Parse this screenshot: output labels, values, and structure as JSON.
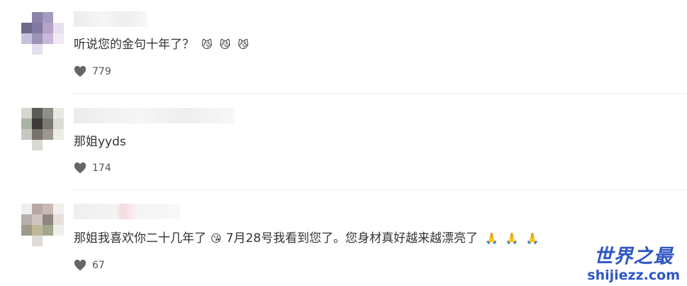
{
  "comments": [
    {
      "text": "听说您的金句十年了？",
      "emojis": [
        "😼",
        "😼",
        "😼"
      ],
      "likes": "779",
      "avatar_colors": [
        "#ffffff",
        "#8b84a8",
        "#a49cc0",
        "#ffffff",
        "#6e6a8e",
        "#7f79a4",
        "#b7a3c6",
        "#e6e0ee",
        "#c9c1dc",
        "#9d93b6",
        "#c7b7d8",
        "#f0eaf4",
        "#ffffff",
        "#e4dff0",
        "#ffffff",
        "#ffffff"
      ]
    },
    {
      "text": "那姐yyds",
      "emojis": [],
      "likes": "174",
      "avatar_colors": [
        "#d6d6d0",
        "#5b5b58",
        "#8f8e88",
        "#e8e8e4",
        "#a9b3a6",
        "#3c3a38",
        "#7c7872",
        "#dcdcd6",
        "#c5c7c0",
        "#77726c",
        "#9b968e",
        "#ebebe7",
        "#ffffff",
        "#d9d8d2",
        "#ffffff",
        "#ffffff"
      ]
    },
    {
      "text": "那姐我喜欢你二十几年了",
      "text_2": "7月28号我看到您了。您身材真好越来越漂亮了",
      "emoji_mid": "😘",
      "emojis": [
        "🙏",
        "🙏",
        "🙏"
      ],
      "likes": "67",
      "avatar_colors": [
        "#eeeeee",
        "#b6a8a8",
        "#c9b9b4",
        "#f2f0ee",
        "#b5b0ae",
        "#d1c4be",
        "#8f8684",
        "#e6e0dd",
        "#9e9a8a",
        "#c0b89a",
        "#a3a58c",
        "#efefe9",
        "#ffffff",
        "#dedad6",
        "#ffffff",
        "#ffffff"
      ]
    }
  ],
  "watermark": {
    "cn": "世界之最",
    "en": "shijiezz.com"
  }
}
